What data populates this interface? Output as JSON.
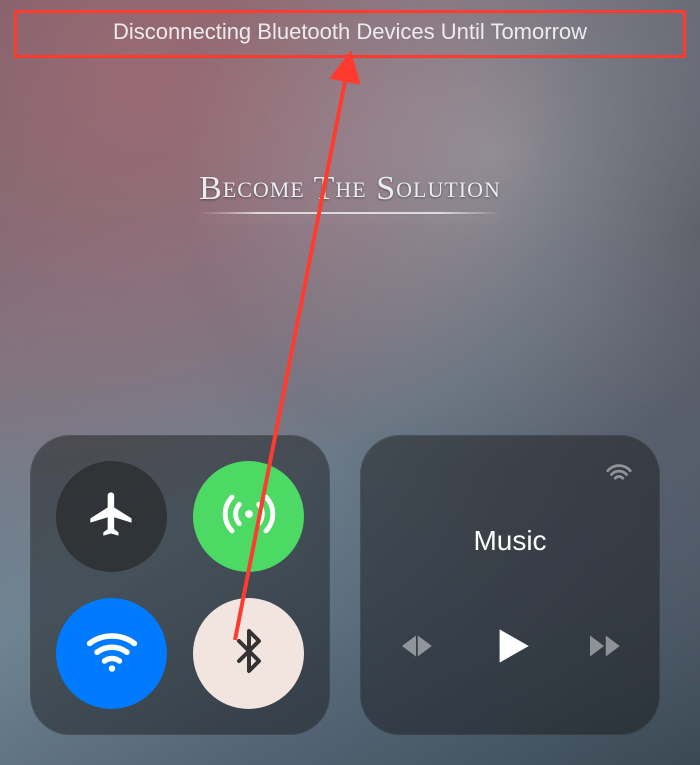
{
  "banner": {
    "text": "Disconnecting Bluetooth Devices Until Tomorrow"
  },
  "watermark": {
    "line1_big_chars": "B",
    "line1_small_1": "ECOME",
    "line1_big_2": " T",
    "line1_small_2": "HE",
    "line1_big_3": " S",
    "line1_small_3": "OLUTION"
  },
  "connectivity": {
    "airplane_state": "off",
    "cellular_state": "on",
    "wifi_state": "on",
    "bluetooth_state": "disconnected"
  },
  "music": {
    "title": "Music"
  },
  "colors": {
    "highlight_border": "#ff3b30",
    "cellular_on": "#4cd964",
    "wifi_on": "#007aff",
    "bt_off": "#f2e4df"
  }
}
